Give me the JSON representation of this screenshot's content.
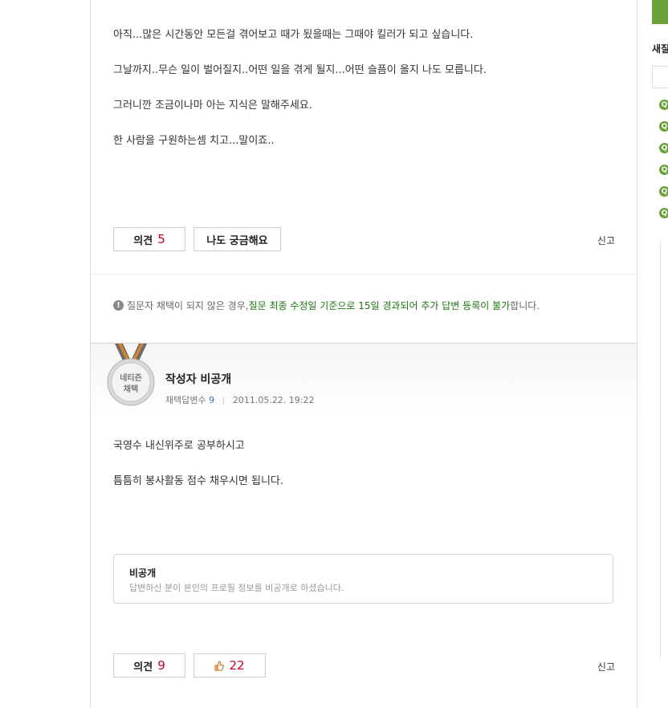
{
  "question": {
    "paragraphs": [
      "아직...많은 시간동안 모든걸 겪어보고 때가 됬을때는 그때야 킬러가 되고 싶습니다.",
      "그날까지..무슨 일이 벌어질지..어떤 일을 겪게 될지...어떤 슬픔이 올지 나도 모릅니다.",
      "그러니깐 조금이나마 아는 지식은 말해주세요.",
      "한 사람을 구원하는셈 치고...말이죠.."
    ],
    "opinion_label": "의견",
    "opinion_count": "5",
    "curious_label": "나도 궁금해요",
    "report_label": "신고"
  },
  "notice": {
    "prefix": "질문자 채택이 되지 않은 경우, ",
    "highlight": "질문 최종 수정일 기준으로 15일 경과되어 추가 답변 등록이 불가",
    "suffix": "합니다."
  },
  "answer": {
    "badge_line1": "네티즌",
    "badge_line2": "채택",
    "author": "작성자 비공개",
    "adopted_label": "채택답변수",
    "adopted_count": "9",
    "date": "2011.05.22. 19:22",
    "paragraphs": [
      "국영수 내신위주로 공부하시고",
      "틈틈히 봉사활동 점수 채우시면 됩니다."
    ],
    "private_title": "비공개",
    "private_desc": "답변하신 분이 본인의 프로필 정보를 비공개로 하셨습니다.",
    "opinion_label": "의견",
    "opinion_count": "9",
    "like_count": "22",
    "report_label": "신고"
  },
  "sidebar": {
    "heading_fragment": "새질"
  },
  "colors": {
    "accent_green": "#6aa23a",
    "highlight_green": "#1b7a0e",
    "count_red": "#d0021b",
    "link_blue": "#3a6fb5"
  }
}
